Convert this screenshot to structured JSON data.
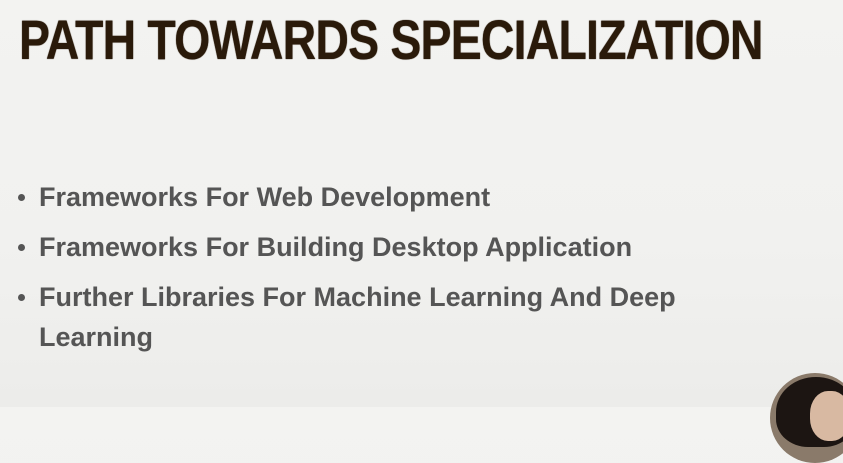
{
  "slide": {
    "title": "PATH TOWARDS SPECIALIZATION",
    "bullets": [
      "Frameworks For Web Development",
      "Frameworks For Building Desktop Application",
      "Further Libraries For Machine Learning And Deep Learning"
    ]
  },
  "colors": {
    "background": "#f2f2f0",
    "title": "#2a1a0a",
    "bullet_text": "#555555"
  }
}
